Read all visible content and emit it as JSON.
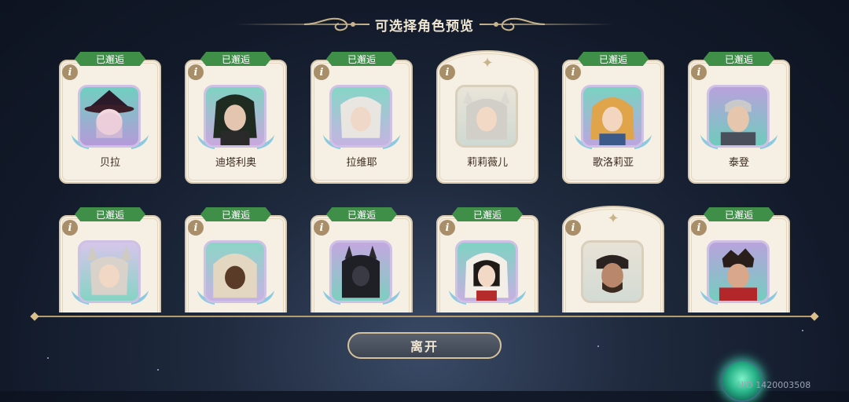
{
  "screen_title": "可选择角色预览",
  "badge_text": "已邂逅",
  "info_icon": "i",
  "leave_button": "离开",
  "uid_text": "UID 1420003508",
  "colors": {
    "badge": "#3f8f49",
    "card": "#f6efe3",
    "border": "#d8c9ae",
    "button_border": "#d6c29a"
  },
  "characters_row1": [
    {
      "name": "贝拉",
      "encountered": true
    },
    {
      "name": "迪塔利奥",
      "encountered": true
    },
    {
      "name": "拉维耶",
      "encountered": true
    },
    {
      "name": "莉莉薇儿",
      "encountered": false
    },
    {
      "name": "歌洛莉亚",
      "encountered": true
    },
    {
      "name": "泰登",
      "encountered": true
    }
  ],
  "characters_row2": [
    {
      "name": "",
      "encountered": true
    },
    {
      "name": "",
      "encountered": true
    },
    {
      "name": "",
      "encountered": true
    },
    {
      "name": "",
      "encountered": true
    },
    {
      "name": "",
      "encountered": false
    },
    {
      "name": "",
      "encountered": true
    }
  ]
}
